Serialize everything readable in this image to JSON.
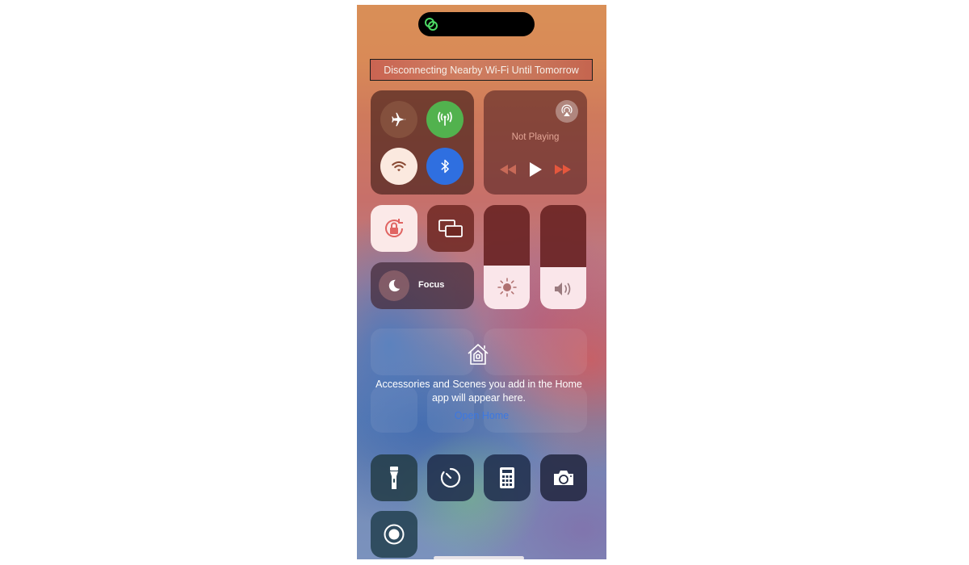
{
  "banner": {
    "text": "Disconnecting Nearby Wi-Fi Until Tomorrow"
  },
  "dynamic_island": {
    "icon": "link-icon",
    "icon_color": "#4cd964"
  },
  "connectivity": {
    "airplane_mode": {
      "icon": "airplane-icon",
      "on": false
    },
    "cellular_data": {
      "icon": "antenna-icon",
      "on": true,
      "color": "#52b24e"
    },
    "wifi": {
      "icon": "wifi-icon",
      "on": true,
      "state": "disconnected-until-tomorrow"
    },
    "bluetooth": {
      "icon": "bluetooth-icon",
      "on": true,
      "color": "#2f6fe0"
    }
  },
  "media": {
    "status": "Not Playing",
    "airplay_icon": "airplay-icon",
    "controls": [
      "rewind-icon",
      "play-icon",
      "fast-forward-icon"
    ]
  },
  "toggles": {
    "orientation_lock": {
      "icon": "rotation-lock-icon",
      "on": true
    },
    "screen_mirroring": {
      "icon": "screen-mirroring-icon"
    },
    "focus": {
      "label": "Focus",
      "icon": "moon-icon"
    }
  },
  "sliders": {
    "brightness": {
      "icon": "sun-icon",
      "level_percent": 42
    },
    "volume": {
      "icon": "speaker-icon",
      "level_percent": 40
    }
  },
  "home": {
    "icon": "home-icon",
    "message": "Accessories and Scenes you add in the Home app will appear here.",
    "open_link": "Open Home",
    "link_color": "#3d78e0"
  },
  "shortcuts": [
    {
      "name": "flashlight",
      "icon": "flashlight-icon"
    },
    {
      "name": "timer",
      "icon": "timer-icon"
    },
    {
      "name": "calculator",
      "icon": "calculator-icon"
    },
    {
      "name": "camera",
      "icon": "camera-icon"
    },
    {
      "name": "screen-recording",
      "icon": "record-icon"
    }
  ]
}
